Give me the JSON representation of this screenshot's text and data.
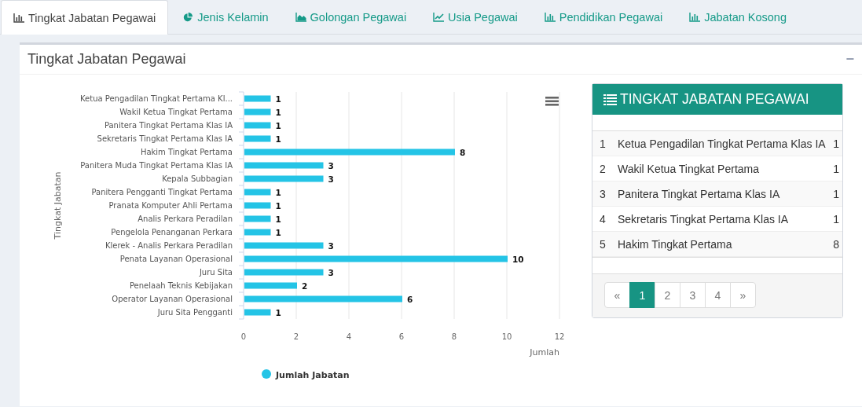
{
  "tabs": [
    {
      "label": "Tingkat Jabatan Pegawai",
      "kind": "bar",
      "selected": true
    },
    {
      "label": "Jenis Kelamin",
      "kind": "pie",
      "selected": false
    },
    {
      "label": "Golongan Pegawai",
      "kind": "area",
      "selected": false
    },
    {
      "label": "Usia Pegawai",
      "kind": "line",
      "selected": false
    },
    {
      "label": "Pendidikan Pegawai",
      "kind": "bar",
      "selected": false
    },
    {
      "label": "Jabatan Kosong",
      "kind": "bar",
      "selected": false
    }
  ],
  "panel": {
    "title": "Tingkat Jabatan Pegawai",
    "collapse": "−"
  },
  "chart": {
    "chart_data": {
      "type": "bar",
      "orientation": "horizontal",
      "xlabel": "Jumlah",
      "ylabel": "Tingkat Jabatan",
      "data_labels": true,
      "grid": true,
      "xlim": [
        0,
        12
      ],
      "xticks": [
        0,
        2,
        4,
        6,
        8,
        10,
        12
      ],
      "categories": [
        "Ketua Pengadilan Tingkat Pertama Kl...",
        "Wakil Ketua Tingkat Pertama",
        "Panitera Tingkat Pertama Klas IA",
        "Sekretaris Tingkat Pertama Klas IA",
        "Hakim Tingkat Pertama",
        "Panitera Muda Tingkat Pertama Klas IA",
        "Kepala Subbagian",
        "Panitera Pengganti Tingkat Pertama",
        "Pranata Komputer Ahli Pertama",
        "Analis Perkara Peradilan",
        "Pengelola Penanganan Perkara",
        "Klerek - Analis Perkara Peradilan",
        "Penata Layanan Operasional",
        "Juru Sita",
        "Penelaah Teknis Kebijakan",
        "Operator Layanan Operasional",
        "Juru Sita Pengganti"
      ],
      "series": [
        {
          "name": "Jumlah Jabatan",
          "color": "#24c4e6",
          "values": [
            1,
            1,
            1,
            1,
            8,
            3,
            3,
            1,
            1,
            1,
            1,
            3,
            10,
            3,
            2,
            6,
            1
          ]
        }
      ]
    }
  },
  "table": {
    "title": "TINGKAT JABATAN PEGAWAI",
    "rows": [
      {
        "no": "1",
        "name": "Ketua Pengadilan Tingkat Pertama Klas IA",
        "count": "1"
      },
      {
        "no": "2",
        "name": "Wakil Ketua Tingkat Pertama",
        "count": "1"
      },
      {
        "no": "3",
        "name": "Panitera Tingkat Pertama Klas IA",
        "count": "1"
      },
      {
        "no": "4",
        "name": "Sekretaris Tingkat Pertama Klas IA",
        "count": "1"
      },
      {
        "no": "5",
        "name": "Hakim Tingkat Pertama",
        "count": "8"
      }
    ],
    "pagination": [
      {
        "label": "«",
        "selected": false
      },
      {
        "label": "1",
        "selected": true
      },
      {
        "label": "2",
        "selected": false
      },
      {
        "label": "3",
        "selected": false
      },
      {
        "label": "4",
        "selected": false
      },
      {
        "label": "»",
        "selected": false
      }
    ]
  }
}
